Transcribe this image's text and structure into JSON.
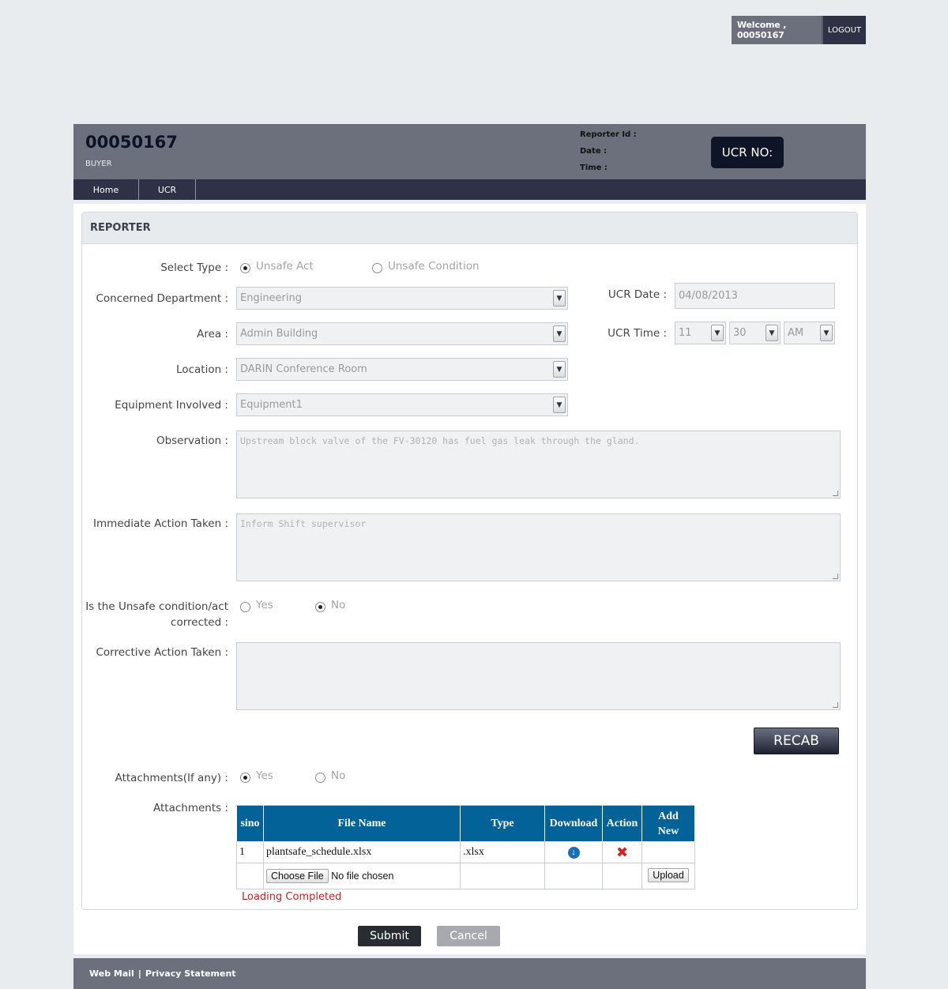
{
  "topbar": {
    "welcome": "Welcome , 00050167",
    "logout": "LOGOUT"
  },
  "header": {
    "user_id": "00050167",
    "role": "BUYER",
    "reporter_id_label": "Reporter Id :",
    "date_label": "Date :",
    "time_label": "Time :",
    "ucr_no_label": "UCR NO:"
  },
  "nav": {
    "items": [
      {
        "label": "Home"
      },
      {
        "label": "UCR"
      }
    ]
  },
  "form": {
    "section_title": "REPORTER",
    "select_type": {
      "label": "Select Type :",
      "option1": "Unsafe Act",
      "option2": "Unsafe Condition",
      "selected": "Unsafe Act"
    },
    "department": {
      "label": "Concerned Department :",
      "value": "Engineering"
    },
    "area": {
      "label": "Area :",
      "value": "Admin Building"
    },
    "location": {
      "label": "Location :",
      "value": "DARIN Conference Room"
    },
    "equipment": {
      "label": "Equipment Involved :",
      "value": "Equipment1"
    },
    "ucr_date": {
      "label": "UCR Date :",
      "value": "04/08/2013"
    },
    "ucr_time": {
      "label": "UCR Time :",
      "hour": "11",
      "minute": "30",
      "ampm": "AM"
    },
    "observation": {
      "label": "Observation :",
      "value": "Upstream block valve of the FV-30120 has fuel gas leak through the gland."
    },
    "immediate_action": {
      "label": "Immediate Action Taken :",
      "value": "Inform Shift supervisor"
    },
    "corrected": {
      "label_line1": "Is the Unsafe condition/act",
      "label_line2": "corrected :",
      "yes": "Yes",
      "no": "No",
      "selected": "No"
    },
    "corrective_action": {
      "label": "Corrective Action Taken :",
      "value": ""
    },
    "recab_button": "RECAB",
    "attachments_any": {
      "label": "Attachments(If any) :",
      "yes": "Yes",
      "no": "No",
      "selected": "Yes"
    },
    "attachments": {
      "label": "Attachments :",
      "headers": {
        "sino": "sino",
        "file_name": "File Name",
        "type": "Type",
        "download": "Download",
        "action": "Action",
        "add_new_line1": "Add",
        "add_new_line2": "New"
      },
      "rows": [
        {
          "sino": "1",
          "file_name": "plantsafe_schedule.xlsx",
          "type": ".xlsx"
        }
      ],
      "choose_file": "Choose File",
      "no_file": "No file chosen",
      "upload": "Upload",
      "status": "Loading Completed"
    }
  },
  "buttons": {
    "submit": "Submit",
    "cancel": "Cancel"
  },
  "footer": {
    "webmail": "Web Mail",
    "separator": "|",
    "privacy": "Privacy Statement"
  }
}
